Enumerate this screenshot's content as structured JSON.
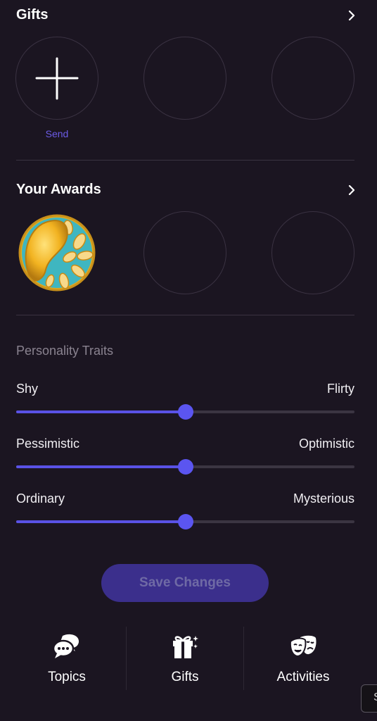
{
  "gifts": {
    "title": "Gifts",
    "send_label": "Send"
  },
  "awards": {
    "title": "Your Awards"
  },
  "traits": {
    "title": "Personality Traits",
    "items": [
      {
        "left": "Shy",
        "right": "Flirty",
        "value": 0.5
      },
      {
        "left": "Pessimistic",
        "right": "Optimistic",
        "value": 0.5
      },
      {
        "left": "Ordinary",
        "right": "Mysterious",
        "value": 0.5
      }
    ]
  },
  "save_label": "Save Changes",
  "tabs": [
    {
      "label": "Topics",
      "icon": "chat-bubbles-icon"
    },
    {
      "label": "Gifts",
      "icon": "gift-icon"
    },
    {
      "label": "Activities",
      "icon": "theater-masks-icon"
    }
  ],
  "corner_tab_label": "S",
  "colors": {
    "background": "#1b1521",
    "accent": "#5b55f0",
    "send": "#6c5ce7",
    "button": "#3b2f8c"
  }
}
